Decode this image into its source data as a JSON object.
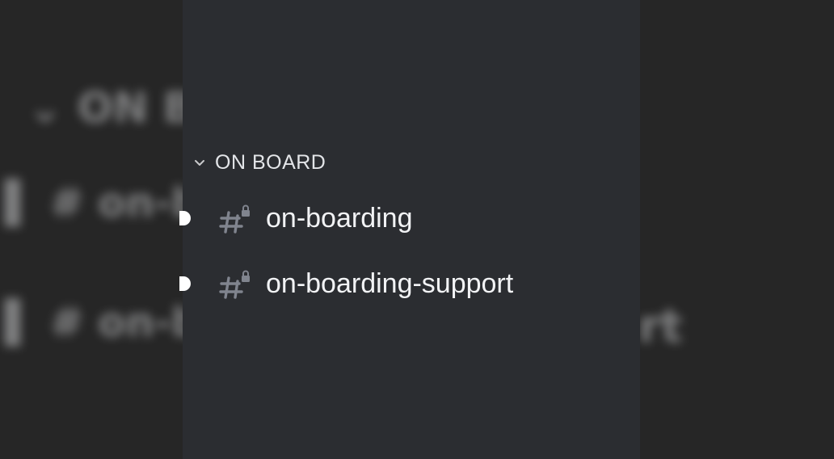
{
  "category": {
    "label": "ON BOARD",
    "chevron_icon": "chevron-down-icon"
  },
  "channels": [
    {
      "name": "on-boarding",
      "icon": "locked-text-channel-icon",
      "unread": true
    },
    {
      "name": "on-boarding-support",
      "icon": "locked-text-channel-icon",
      "unread": true
    }
  ],
  "colors": {
    "background": "#262626",
    "panel": "#2b2d31",
    "text": "#f2f3f5",
    "header": "#e3e5e8",
    "icon": "#80848e",
    "unread_pill": "#ffffff"
  }
}
